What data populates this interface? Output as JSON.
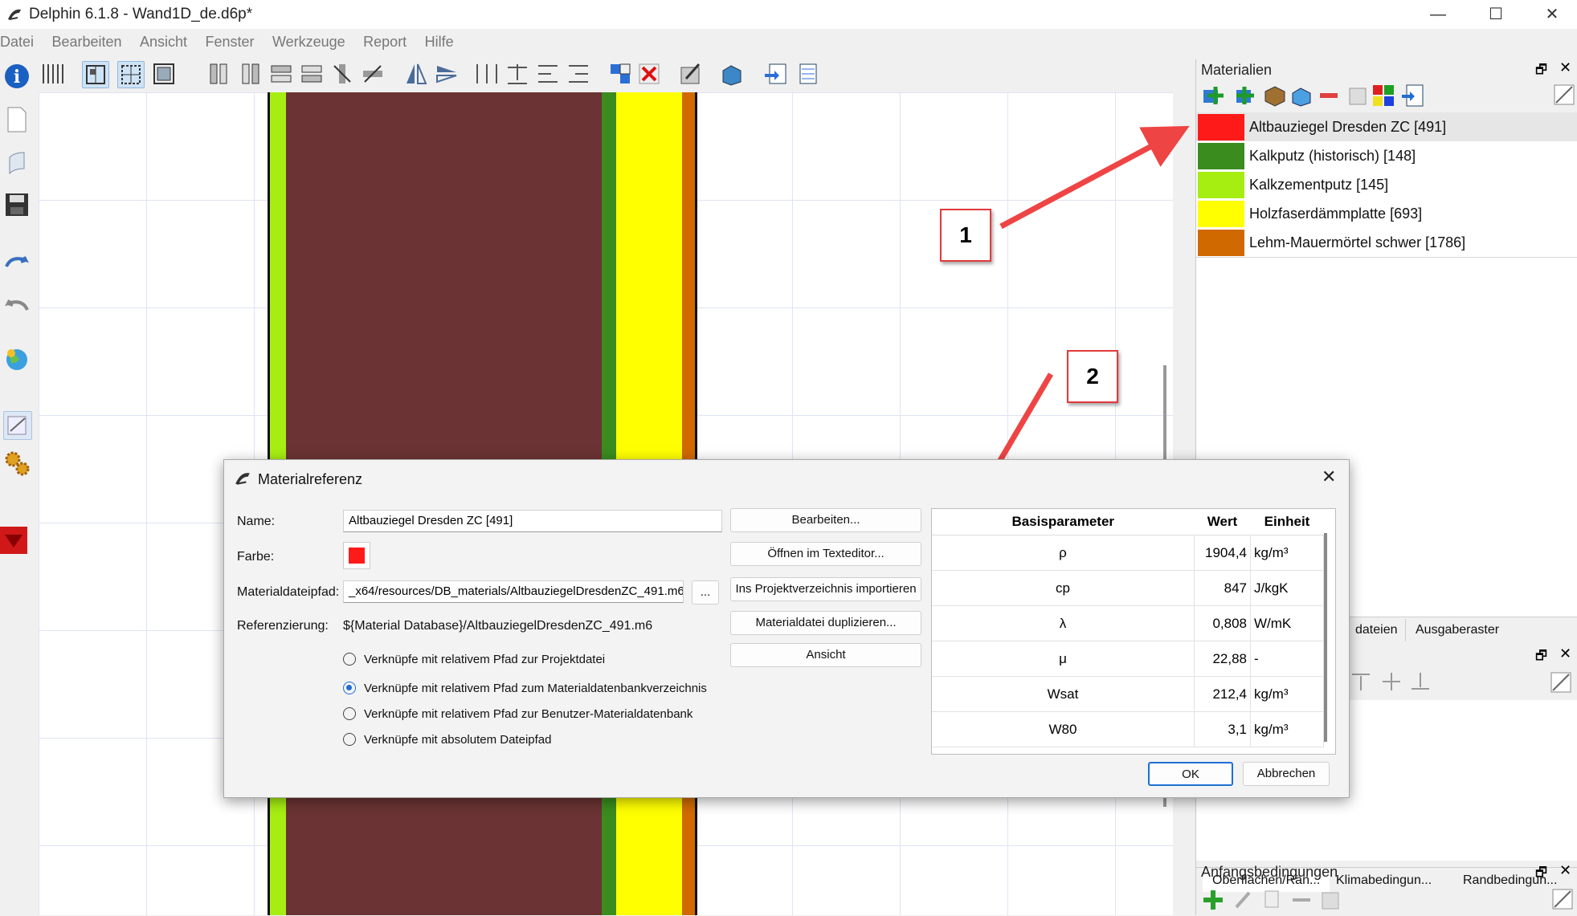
{
  "window": {
    "title": "Delphin 6.1.8 - Wand1D_de.d6p*"
  },
  "menu": [
    "Datei",
    "Bearbeiten",
    "Ansicht",
    "Fenster",
    "Werkzeuge",
    "Report",
    "Hilfe"
  ],
  "materials_panel": {
    "title": "Materialien",
    "items": [
      {
        "label": "Altbauziegel Dresden ZC [491]",
        "color": "#ff1a1a"
      },
      {
        "label": "Kalkputz (historisch) [148]",
        "color": "#3a8c1e"
      },
      {
        "label": "Kalkzementputz [145]",
        "color": "#a6ee12"
      },
      {
        "label": "Holzfaserdämmplatte [693]",
        "color": "#ffff00"
      },
      {
        "label": "Lehm-Mauermörtel schwer [1786]",
        "color": "#d06a00"
      }
    ]
  },
  "mid_tabs": [
    "dateien",
    "Ausgaberaster"
  ],
  "bottom_tabs": [
    "Oberflächen/Rän...",
    "Klimabedingun...",
    "Randbedingun..."
  ],
  "initial_conditions_panel": {
    "title": "Anfangsbedingungen"
  },
  "annotations": {
    "callout1": "1",
    "callout2": "2"
  },
  "dialog": {
    "title": "Materialreferenz",
    "labels": {
      "name": "Name:",
      "color": "Farbe:",
      "path": "Materialdateipfad:",
      "reference": "Referenzierung:"
    },
    "name_value": "Altbauziegel Dresden ZC [491]",
    "color_value": "#ff1a1a",
    "path_value": "_x64/resources/DB_materials/AltbauziegelDresdenZC_491.m6",
    "browse_label": "...",
    "reference_value": "${Material Database}/AltbauziegelDresdenZC_491.m6",
    "buttons": {
      "edit": "Bearbeiten...",
      "open_editor": "Öffnen im Texteditor...",
      "import": "Ins Projektverzeichnis importieren",
      "duplicate": "Materialdatei duplizieren...",
      "view": "Ansicht",
      "ok": "OK",
      "cancel": "Abbrechen"
    },
    "radios": [
      {
        "label": "Verknüpfe mit relativem Pfad zur Projektdatei",
        "checked": false
      },
      {
        "label": "Verknüpfe mit relativem Pfad zum Materialdatenbankverzeichnis",
        "checked": true
      },
      {
        "label": "Verknüpfe mit relativem Pfad zur Benutzer-Materialdatenbank",
        "checked": false
      },
      {
        "label": "Verknüpfe mit absolutem Dateipfad",
        "checked": false
      }
    ],
    "table": {
      "headers": [
        "Basisparameter",
        "Wert",
        "Einheit"
      ],
      "rows": [
        {
          "param": "ρ",
          "value": "1904,4",
          "unit": "kg/m³"
        },
        {
          "param": "cp",
          "value": "847",
          "unit": "J/kgK"
        },
        {
          "param": "λ",
          "value": "0,808",
          "unit": "W/mK"
        },
        {
          "param": "μ",
          "value": "22,88",
          "unit": "-"
        },
        {
          "param": "Wsat",
          "value": "212,4",
          "unit": "kg/m³"
        },
        {
          "param": "W80",
          "value": "3,1",
          "unit": "kg/m³"
        }
      ]
    }
  }
}
